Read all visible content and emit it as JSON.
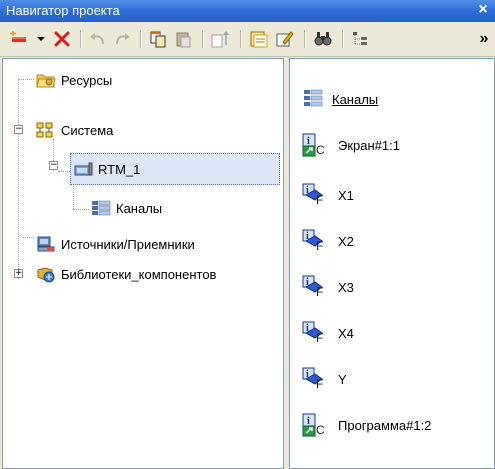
{
  "window": {
    "title": "Навигатор проекта",
    "close_glyph": "×"
  },
  "toolbar": {
    "buttons": [
      {
        "icon": "new-item-icon"
      },
      {
        "icon": "dropdown-arrow-icon"
      },
      {
        "icon": "delete-icon"
      },
      {
        "icon": "undo-icon"
      },
      {
        "icon": "redo-icon"
      },
      {
        "icon": "copy-icon"
      },
      {
        "icon": "paste-icon"
      },
      {
        "icon": "sort-icon"
      },
      {
        "icon": "properties-icon"
      },
      {
        "icon": "edit-icon"
      },
      {
        "icon": "find-icon"
      },
      {
        "icon": "tree-view-icon"
      },
      {
        "icon": "more-icon"
      }
    ],
    "more_glyph": "»"
  },
  "tree": {
    "items": [
      {
        "label": "Ресурсы",
        "icon": "folder-icon"
      },
      {
        "label": "Система",
        "icon": "network-icon",
        "expander": "−"
      },
      {
        "label": "RTM_1",
        "icon": "computer-icon",
        "expander": "−",
        "selected": true
      },
      {
        "label": "Каналы",
        "icon": "channels-icon"
      },
      {
        "label": "Источники/Приемники",
        "icon": "sources-icon"
      },
      {
        "label": "Библиотеки_компонентов",
        "icon": "library-icon",
        "expander": "+"
      }
    ]
  },
  "list": {
    "items": [
      {
        "label": "Каналы",
        "icon": "channels-icon",
        "sub": ""
      },
      {
        "label": "Экран#1:1",
        "icon": "program-c-icon",
        "sub": "C"
      },
      {
        "label": "X1",
        "icon": "program-f-icon",
        "sub": "F"
      },
      {
        "label": "X2",
        "icon": "program-f-icon",
        "sub": "F"
      },
      {
        "label": "X3",
        "icon": "program-f-icon",
        "sub": "F"
      },
      {
        "label": "X4",
        "icon": "program-f-icon",
        "sub": "F"
      },
      {
        "label": "Y",
        "icon": "program-f-icon",
        "sub": "F"
      },
      {
        "label": "Программа#1:2",
        "icon": "program-c-icon",
        "sub": "C"
      }
    ]
  }
}
